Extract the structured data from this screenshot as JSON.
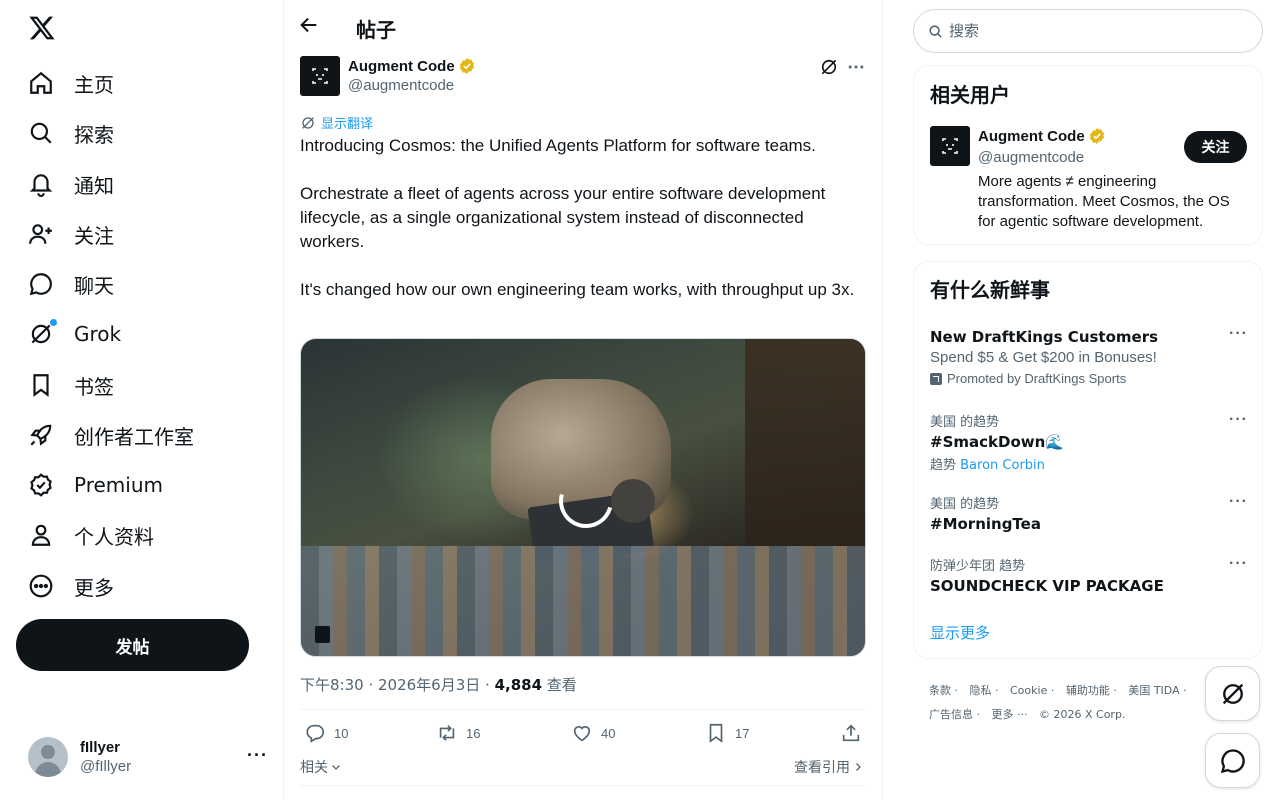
{
  "nav": {
    "items": [
      {
        "label": "主页",
        "icon": "home-icon"
      },
      {
        "label": "探索",
        "icon": "search-icon"
      },
      {
        "label": "通知",
        "icon": "bell-icon"
      },
      {
        "label": "关注",
        "icon": "add-user-icon"
      },
      {
        "label": "聊天",
        "icon": "chat-icon"
      },
      {
        "label": "Grok",
        "icon": "grok-icon"
      },
      {
        "label": "书签",
        "icon": "bookmark-icon"
      },
      {
        "label": "创作者工作室",
        "icon": "rocket-icon"
      },
      {
        "label": "Premium",
        "icon": "premium-icon"
      },
      {
        "label": "个人资料",
        "icon": "profile-icon"
      },
      {
        "label": "更多",
        "icon": "more-circle-icon"
      }
    ],
    "post_button": "发帖"
  },
  "account": {
    "name": "fIllyer",
    "handle": "@fIllyer"
  },
  "header": {
    "title": "帖子"
  },
  "tweet": {
    "author_name": "Augment Code",
    "author_handle": "@augmentcode",
    "translate_label": "显示翻译",
    "text": [
      "Introducing Cosmos: the Unified Agents Platform for software teams.",
      "Orchestrate a fleet of agents across your entire software development lifecycle, as a single organizational system instead of disconnected workers.",
      "It's changed how our own engineering team works, with throughput up 3x."
    ],
    "time": "下午8:30 · 2026年6月3日 · ",
    "views": "4,884",
    "views_label": " 查看",
    "replies": "10",
    "retweets": "16",
    "likes": "40",
    "bookmarks": "17",
    "related_label": "相关",
    "quotes_label": "查看引用"
  },
  "search": {
    "placeholder": "搜索"
  },
  "related_users": {
    "title": "相关用户",
    "user": {
      "name": "Augment Code",
      "handle": "@augmentcode",
      "bio": "More agents ≠ engineering transformation. Meet Cosmos, the OS for agentic software development.",
      "follow_label": "关注"
    }
  },
  "trends": {
    "title": "有什么新鲜事",
    "items": [
      {
        "name": "New DraftKings Customers",
        "sub": "Spend $5 & Get $200 in Bonuses!",
        "promo": "Promoted by DraftKings Sports"
      },
      {
        "context": "美国 的趋势",
        "name": "#SmackDown🌊",
        "sub_prefix": "趋势 ",
        "sub_link": "Baron Corbin"
      },
      {
        "context": "美国 的趋势",
        "name": "#MorningTea"
      },
      {
        "context": "防弹少年团 趋势",
        "name": "SOUNDCHECK VIP PACKAGE"
      }
    ],
    "show_more": "显示更多"
  },
  "footer": {
    "line1": [
      "条款 ·",
      "隐私 ·",
      "Cookie ·",
      "辅助功能 ·",
      "美国 TIDA ·"
    ],
    "line2": [
      "广告信息 ·",
      "更多 ···",
      "© 2026 X Corp."
    ]
  },
  "colors": {
    "accent": "#1d9bf0",
    "text": "#0f1419",
    "muted": "#536471",
    "verified": "#e2b719"
  }
}
